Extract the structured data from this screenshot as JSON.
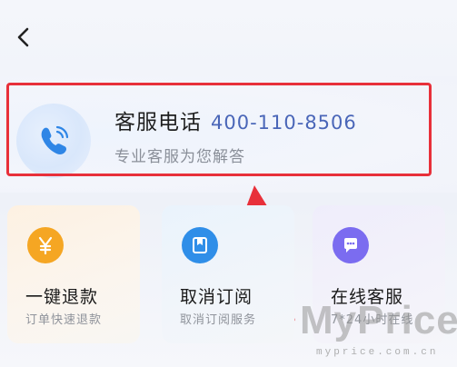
{
  "nav": {
    "back_icon": "chevron-left-icon"
  },
  "hero": {
    "title": "客服电话",
    "phone": "400-110-8506",
    "subtitle": "专业客服为您解答",
    "icon": "phone-icon",
    "highlight_color": "#e8303a"
  },
  "cards": [
    {
      "title": "一键退款",
      "subtitle": "订单快速退款",
      "icon": "yen-icon",
      "accent": "#f5a623"
    },
    {
      "title": "取消订阅",
      "subtitle": "取消订阅服务",
      "icon": "bookmark-icon",
      "accent": "#2f8ee8"
    },
    {
      "title": "在线客服",
      "subtitle": "7*24小时在线",
      "icon": "chat-icon",
      "accent": "#7b6cf0"
    }
  ],
  "watermark": {
    "brand": "MyPrice",
    "domain": "myprice.com.cn"
  }
}
